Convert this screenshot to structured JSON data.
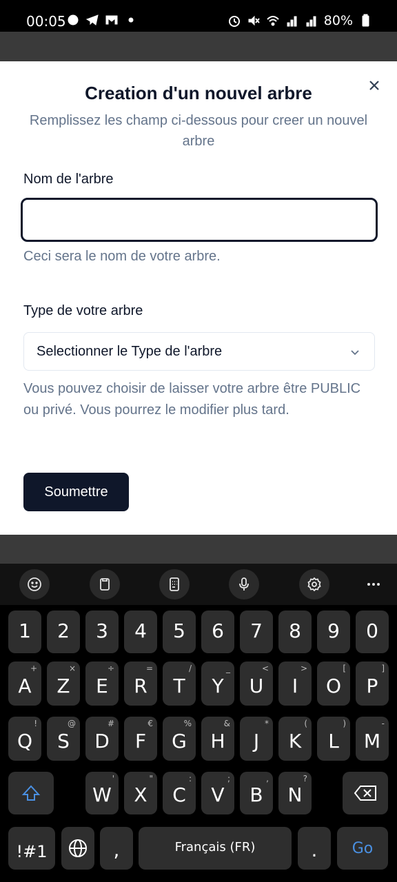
{
  "status_bar": {
    "time": "00:05",
    "battery": "80%",
    "icons_left": [
      "notification-icon",
      "telegram-icon",
      "gmail-icon",
      "dot-icon"
    ],
    "icons_right": [
      "alarm-icon",
      "mute-icon",
      "wifi-icon",
      "signal-icon",
      "signal-icon",
      "battery-icon"
    ]
  },
  "modal": {
    "title": "Creation d'un nouvel arbre",
    "description": "Remplissez les champ ci-dessous pour creer un nouvel arbre",
    "name_label": "Nom de l'arbre",
    "name_value": "",
    "name_hint": "Ceci sera le nom de votre arbre.",
    "type_label": "Type de votre arbre",
    "type_selected": "Selectionner le Type de l'arbre",
    "type_hint": "Vous pouvez choisir de laisser votre arbre être PUBLIC ou privé. Vous pourrez le modifier plus tard.",
    "submit_label": "Soumettre"
  },
  "keyboard": {
    "toolbar": [
      "emoji-icon",
      "clipboard-icon",
      "keypad-icon",
      "microphone-icon",
      "settings-icon",
      "more-icon"
    ],
    "row_numbers": [
      "1",
      "2",
      "3",
      "4",
      "5",
      "6",
      "7",
      "8",
      "9",
      "0"
    ],
    "row1": [
      {
        "k": "A",
        "s": "+"
      },
      {
        "k": "Z",
        "s": "×"
      },
      {
        "k": "E",
        "s": "÷"
      },
      {
        "k": "R",
        "s": "="
      },
      {
        "k": "T",
        "s": "/"
      },
      {
        "k": "Y",
        "s": "_"
      },
      {
        "k": "U",
        "s": "<"
      },
      {
        "k": "I",
        "s": ">"
      },
      {
        "k": "O",
        "s": "["
      },
      {
        "k": "P",
        "s": "]"
      }
    ],
    "row2": [
      {
        "k": "Q",
        "s": "!"
      },
      {
        "k": "S",
        "s": "@"
      },
      {
        "k": "D",
        "s": "#"
      },
      {
        "k": "F",
        "s": "€"
      },
      {
        "k": "G",
        "s": "%"
      },
      {
        "k": "H",
        "s": "&"
      },
      {
        "k": "J",
        "s": "*"
      },
      {
        "k": "K",
        "s": "("
      },
      {
        "k": "L",
        "s": ")"
      },
      {
        "k": "M",
        "s": "-"
      }
    ],
    "row3": [
      {
        "k": "W",
        "s": "'"
      },
      {
        "k": "X",
        "s": "\""
      },
      {
        "k": "C",
        "s": ":"
      },
      {
        "k": "V",
        "s": ";"
      },
      {
        "k": "B",
        "s": ","
      },
      {
        "k": "N",
        "s": "?"
      }
    ],
    "symbols_label": "!#1",
    "comma": ",",
    "space_label": "Français (FR)",
    "period": ".",
    "go_label": "Go"
  }
}
